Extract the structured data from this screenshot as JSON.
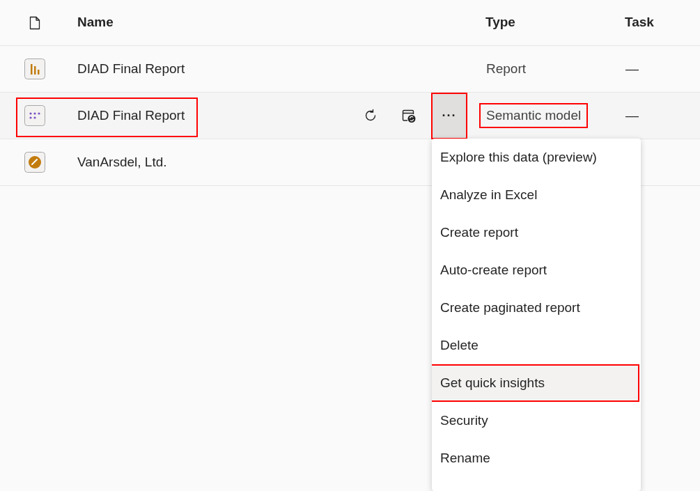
{
  "header": {
    "name": "Name",
    "type": "Type",
    "task": "Task"
  },
  "rows": [
    {
      "kind": "report",
      "name": "DIAD Final Report",
      "type": "Report",
      "task": "—",
      "hovered": false,
      "highlighted": false
    },
    {
      "kind": "semantic_model",
      "name": "DIAD Final Report",
      "type": "Semantic model",
      "task": "—",
      "hovered": true,
      "highlighted": true
    },
    {
      "kind": "dashboard",
      "name": "VanArsdel, Ltd.",
      "hovered": false,
      "highlighted": false
    }
  ],
  "more_button": {
    "label": "···",
    "highlighted": true
  },
  "menu": {
    "items": [
      {
        "label": "Explore this data (preview)",
        "hovered": false,
        "highlighted": false
      },
      {
        "label": "Analyze in Excel",
        "hovered": false,
        "highlighted": false
      },
      {
        "label": "Create report",
        "hovered": false,
        "highlighted": false
      },
      {
        "label": "Auto-create report",
        "hovered": false,
        "highlighted": false
      },
      {
        "label": "Create paginated report",
        "hovered": false,
        "highlighted": false
      },
      {
        "label": "Delete",
        "hovered": false,
        "highlighted": false
      },
      {
        "label": "Get quick insights",
        "hovered": true,
        "highlighted": true
      },
      {
        "label": "Security",
        "hovered": false,
        "highlighted": false
      },
      {
        "label": "Rename",
        "hovered": false,
        "highlighted": false
      }
    ]
  }
}
